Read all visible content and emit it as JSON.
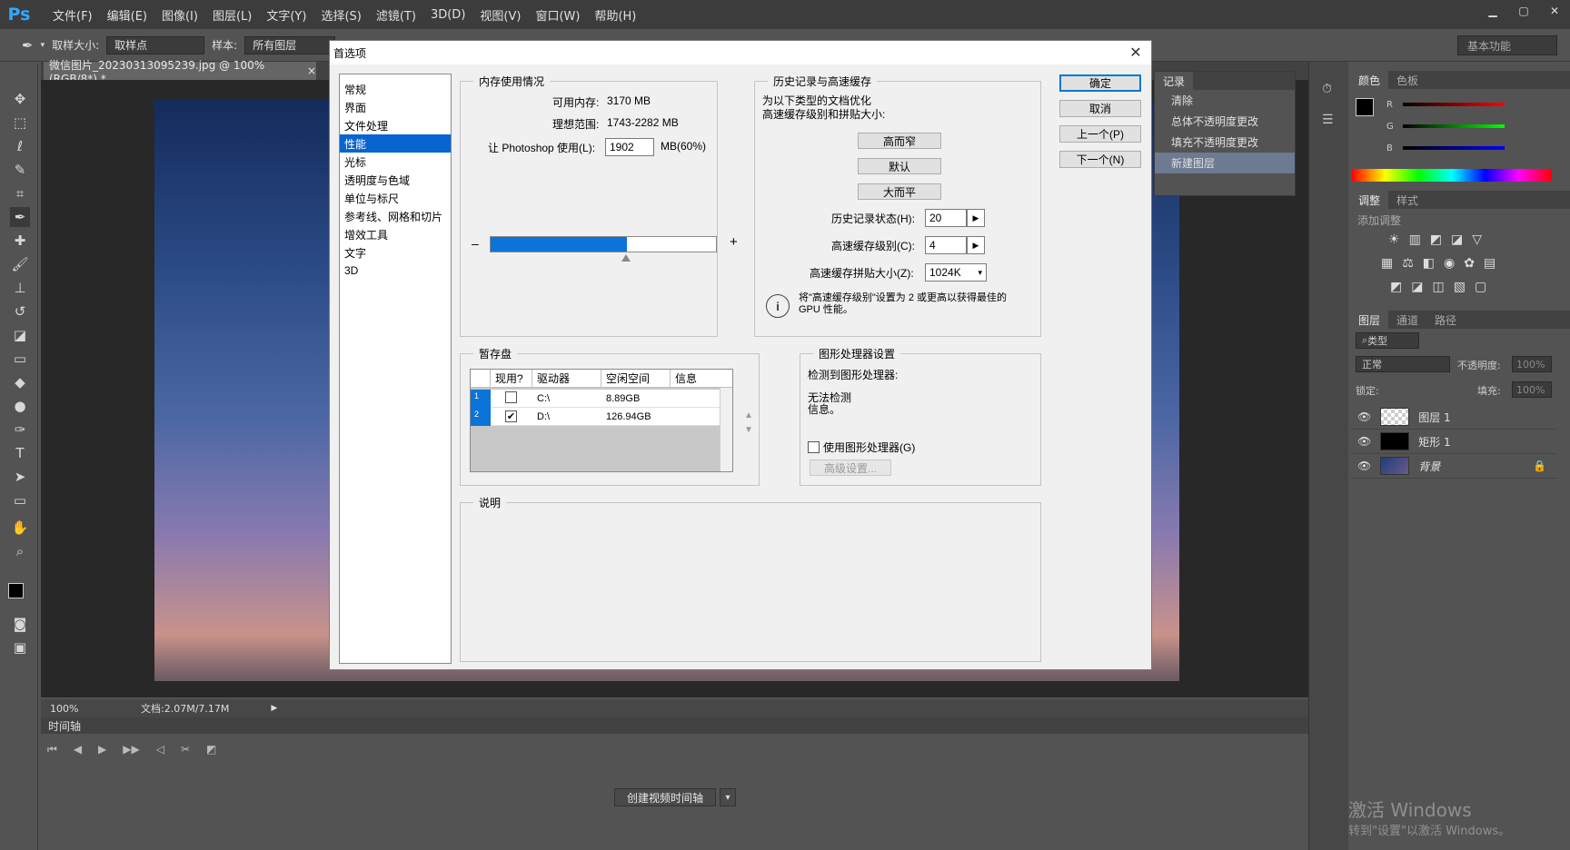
{
  "app": {
    "logo": "Ps"
  },
  "menu": [
    "文件(F)",
    "编辑(E)",
    "图像(I)",
    "图层(L)",
    "文字(Y)",
    "选择(S)",
    "滤镜(T)",
    "3D(D)",
    "视图(V)",
    "窗口(W)",
    "帮助(H)"
  ],
  "options": {
    "sample_size_label": "取样大小:",
    "sample_size_value": "取样点",
    "sample_label": "样本:",
    "sample_value": "所有图层",
    "workspace": "基本功能"
  },
  "document": {
    "tab_title": "微信图片_20230313095239.jpg @ 100%(RGB/8*) *",
    "zoom": "100%",
    "doc_info": "文档:2.07M/7.17M"
  },
  "timeline": {
    "title": "时间轴",
    "create_button": "创建视频时间轴"
  },
  "history_panel": {
    "tab": "记录",
    "items": [
      "清除",
      "总体不透明度更改",
      "填充不透明度更改",
      "新建图层"
    ]
  },
  "color_panel": {
    "tabs": [
      "颜色",
      "色板"
    ],
    "channels": [
      "R",
      "G",
      "B"
    ]
  },
  "adjust_panel": {
    "tabs": [
      "调整",
      "样式"
    ],
    "title": "添加调整"
  },
  "layers_panel": {
    "tabs": [
      "图层",
      "通道",
      "路径"
    ],
    "filter": "类型",
    "blend_mode": "正常",
    "opacity_label": "不透明度:",
    "opacity_value": "100%",
    "lock_label": "锁定:",
    "fill_label": "填充:",
    "fill_value": "100%",
    "layers": [
      {
        "name": "图层 1"
      },
      {
        "name": "矩形 1"
      },
      {
        "name": "背景"
      }
    ]
  },
  "watermark": {
    "line1": "激活 Windows",
    "line2": "转到\"设置\"以激活 Windows。"
  },
  "dialog": {
    "title": "首选项",
    "categories": [
      "常规",
      "界面",
      "文件处理",
      "性能",
      "光标",
      "透明度与色域",
      "单位与标尺",
      "参考线、网格和切片",
      "增效工具",
      "文字",
      "3D"
    ],
    "selected_category": 3,
    "memory": {
      "title": "内存使用情况",
      "available_label": "可用内存:",
      "available_value": "3170 MB",
      "ideal_label": "理想范围:",
      "ideal_value": "1743-2282 MB",
      "use_label": "让 Photoshop 使用(L):",
      "use_value": "1902",
      "use_unit": "MB(60%)",
      "slider_fraction": 0.6,
      "minus": "–",
      "plus": "+"
    },
    "history": {
      "title": "历史记录与高速缓存",
      "desc": "为以下类型的文档优化\n高速缓存级别和拼贴大小:",
      "btn_tall": "高而窄",
      "btn_default": "默认",
      "btn_wide": "大而平",
      "states_label": "历史记录状态(H):",
      "states_value": "20",
      "levels_label": "高速缓存级别(C):",
      "levels_value": "4",
      "tile_label": "高速缓存拼贴大小(Z):",
      "tile_value": "1024K",
      "info_text": "将\"高速缓存级别\"设置为 2 或更高以获得最佳的\nGPU 性能。"
    },
    "scratch": {
      "title": "暂存盘",
      "headers": [
        "现用?",
        "驱动器",
        "空闲空间",
        "信息"
      ],
      "rows": [
        {
          "num": "1",
          "checked": false,
          "drive": "C:\\",
          "free": "8.89GB",
          "info": ""
        },
        {
          "num": "2",
          "checked": true,
          "drive": "D:\\",
          "free": "126.94GB",
          "info": ""
        }
      ]
    },
    "gpu": {
      "title": "图形处理器设置",
      "detected_label": "检测到图形处理器:",
      "detected_value": "无法检测\n信息。",
      "use_gpu_label": "使用图形处理器(G)",
      "advanced_button": "高级设置..."
    },
    "description": {
      "title": "说明"
    },
    "buttons": {
      "ok": "确定",
      "cancel": "取消",
      "prev": "上一个(P)",
      "next": "下一个(N)"
    }
  }
}
